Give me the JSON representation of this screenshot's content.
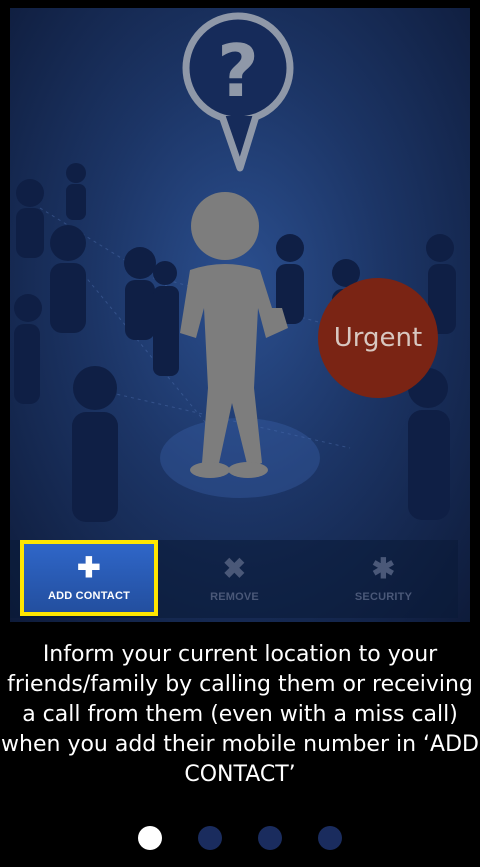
{
  "hero": {
    "badge_label": "Urgent"
  },
  "toolbar": {
    "add_label": "ADD CONTACT",
    "remove_label": "REMOVE",
    "security_label": "SECURITY",
    "add_icon": "plus-icon",
    "remove_icon": "x-icon",
    "security_icon": "gear-icon"
  },
  "caption": {
    "text": "Inform your current location to your friends/family by calling them or receiving a call from them (even with a miss call) when you add their mobile number in ‘ADD CONTACT’"
  },
  "pager": {
    "total": 4,
    "current": 1
  },
  "colors": {
    "highlight": "#ffe600",
    "urgent": "#7a2414",
    "active_tab": "#2f66c8"
  }
}
